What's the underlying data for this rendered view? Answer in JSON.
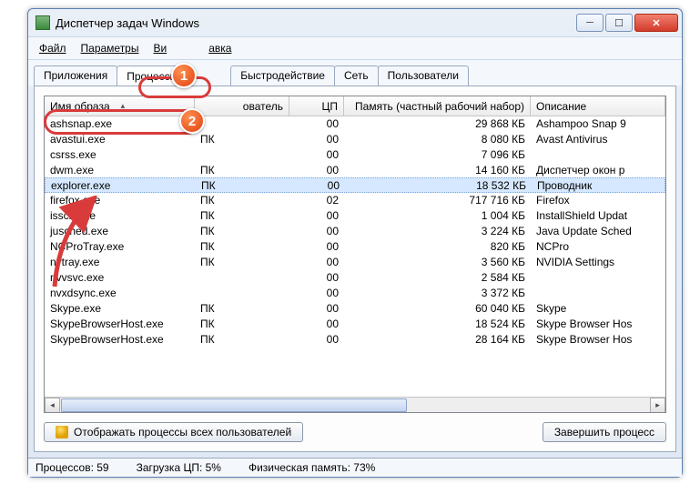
{
  "window": {
    "title": "Диспетчер задач Windows"
  },
  "menu": {
    "file": "Файл",
    "options": "Параметры",
    "view": "Вид",
    "help": "Справка",
    "viewPartial": "Ви",
    "helpPartial": "авка"
  },
  "tabs": {
    "apps": "Приложения",
    "processes": "Процессы",
    "perf": "Быстродействие",
    "net": "Сеть",
    "users": "Пользователи"
  },
  "columns": {
    "name": "Имя образа",
    "user": "ователь",
    "userPartial": "ователь",
    "cpu": "ЦП",
    "mem": "Память (частный рабочий набор)",
    "desc": "Описание"
  },
  "rows": [
    {
      "name": "ashsnap.exe",
      "user": "",
      "cpu": "00",
      "mem": "29 868 КБ",
      "desc": "Ashampoo Snap 9"
    },
    {
      "name": "avastui.exe",
      "user": "ПК",
      "cpu": "00",
      "mem": "8 080 КБ",
      "desc": "Avast Antivirus"
    },
    {
      "name": "csrss.exe",
      "user": "",
      "cpu": "00",
      "mem": "7 096 КБ",
      "desc": ""
    },
    {
      "name": "dwm.exe",
      "user": "ПК",
      "cpu": "00",
      "mem": "14 160 КБ",
      "desc": "Диспетчер окон р"
    },
    {
      "name": "explorer.exe",
      "user": "ПК",
      "cpu": "00",
      "mem": "18 532 КБ",
      "desc": "Проводник",
      "selected": true
    },
    {
      "name": "firefox.exe",
      "user": "ПК",
      "cpu": "02",
      "mem": "717 716 КБ",
      "desc": "Firefox"
    },
    {
      "name": "issch.exe",
      "user": "ПК",
      "cpu": "00",
      "mem": "1 004 КБ",
      "desc": "InstallShield Updat"
    },
    {
      "name": "jusched.exe",
      "user": "ПК",
      "cpu": "00",
      "mem": "3 224 КБ",
      "desc": "Java Update Sched"
    },
    {
      "name": "NCProTray.exe",
      "user": "ПК",
      "cpu": "00",
      "mem": "820 КБ",
      "desc": "NCPro"
    },
    {
      "name": "nvtray.exe",
      "user": "ПК",
      "cpu": "00",
      "mem": "3 560 КБ",
      "desc": "NVIDIA Settings"
    },
    {
      "name": "nvvsvc.exe",
      "user": "",
      "cpu": "00",
      "mem": "2 584 КБ",
      "desc": ""
    },
    {
      "name": "nvxdsync.exe",
      "user": "",
      "cpu": "00",
      "mem": "3 372 КБ",
      "desc": ""
    },
    {
      "name": "Skype.exe",
      "user": "ПК",
      "cpu": "00",
      "mem": "60 040 КБ",
      "desc": "Skype"
    },
    {
      "name": "SkypeBrowserHost.exe",
      "user": "ПК",
      "cpu": "00",
      "mem": "18 524 КБ",
      "desc": "Skype Browser Hos"
    },
    {
      "name": "SkypeBrowserHost.exe",
      "user": "ПК",
      "cpu": "00",
      "mem": "28 164 КБ",
      "desc": "Skype Browser Hos"
    }
  ],
  "buttons": {
    "showAll": "Отображать процессы всех пользователей",
    "end": "Завершить процесс"
  },
  "status": {
    "procs": "Процессов: 59",
    "cpu": "Загрузка ЦП: 5%",
    "mem": "Физическая память: 73%"
  },
  "badges": {
    "one": "1",
    "two": "2"
  }
}
